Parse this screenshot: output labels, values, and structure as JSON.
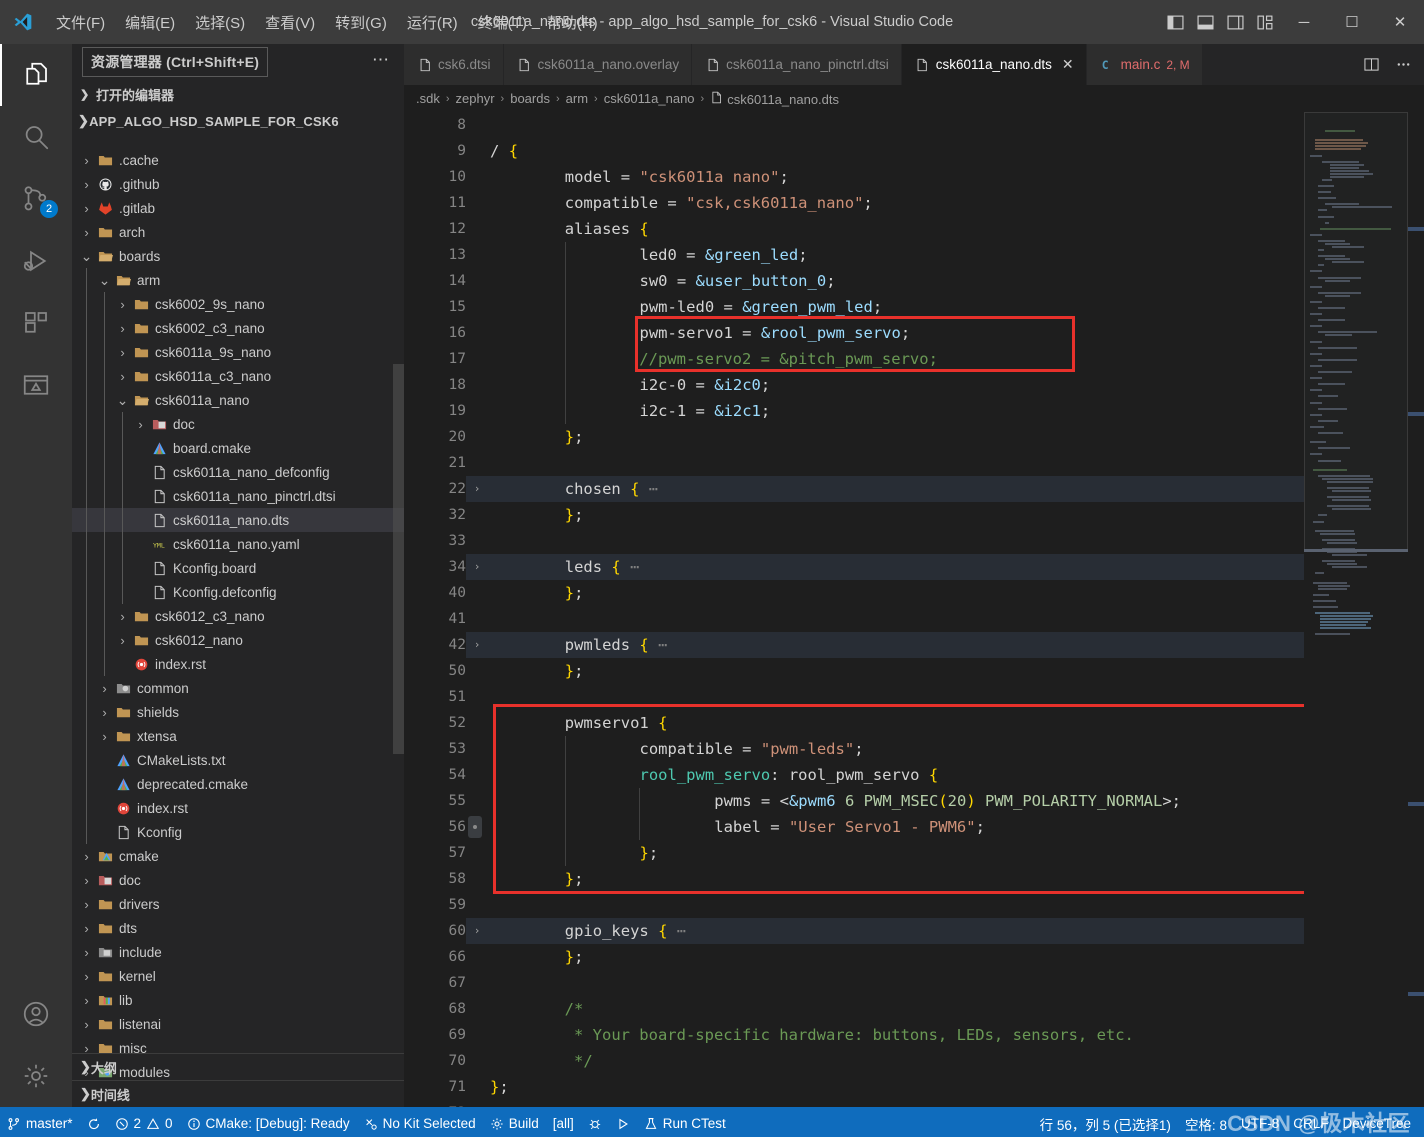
{
  "titlebar": {
    "logo_icon": "vscode-logo-icon",
    "menus": [
      "文件(F)",
      "编辑(E)",
      "选择(S)",
      "查看(V)",
      "转到(G)",
      "运行(R)",
      "终端(T)",
      "帮助(H)"
    ],
    "window_title": "csk6011a_nano.dts - app_algo_hsd_sample_for_csk6 - Visual Studio Code",
    "layout_icons": [
      "toggle-primary-sidebar-icon",
      "toggle-panel-icon",
      "toggle-secondary-sidebar-icon",
      "customize-layout-icon"
    ],
    "window_controls": {
      "minimize": "─",
      "maximize": "☐",
      "close": "✕"
    }
  },
  "activitybar": {
    "items": [
      {
        "name": "explorer",
        "icon": "files-icon",
        "badge": ""
      },
      {
        "name": "search",
        "icon": "search-icon",
        "badge": ""
      },
      {
        "name": "source-control",
        "icon": "source-control-icon",
        "badge": "2"
      },
      {
        "name": "run-and-debug",
        "icon": "run-debug-icon",
        "badge": ""
      },
      {
        "name": "extensions",
        "icon": "extensions-icon",
        "badge": ""
      },
      {
        "name": "embedded-tools",
        "icon": "embedded-icon",
        "badge": ""
      }
    ],
    "bottom": [
      {
        "name": "accounts",
        "icon": "account-icon"
      },
      {
        "name": "manage",
        "icon": "gear-icon"
      }
    ]
  },
  "sidebar": {
    "title": "资源管理器 (Ctrl+Shift+E)",
    "more_actions": "⋯",
    "open_editors_label": "打开的编辑器",
    "root_label": "APP_ALGO_HSD_SAMPLE_FOR_CSK6",
    "bottom_panels": [
      "大纲",
      "时间线"
    ],
    "tree": [
      {
        "label": ".cache",
        "indent": 1,
        "type": "folder",
        "expandable": true,
        "expanded": false
      },
      {
        "label": ".github",
        "indent": 1,
        "type": "github",
        "expandable": true,
        "expanded": false
      },
      {
        "label": ".gitlab",
        "indent": 1,
        "type": "gitlab",
        "expandable": true,
        "expanded": false
      },
      {
        "label": "arch",
        "indent": 1,
        "type": "folder",
        "expandable": true,
        "expanded": false
      },
      {
        "label": "boards",
        "indent": 1,
        "type": "folder-open",
        "expandable": true,
        "expanded": true
      },
      {
        "label": "arm",
        "indent": 2,
        "type": "folder-open",
        "expandable": true,
        "expanded": true
      },
      {
        "label": "csk6002_9s_nano",
        "indent": 3,
        "type": "folder",
        "expandable": true,
        "expanded": false
      },
      {
        "label": "csk6002_c3_nano",
        "indent": 3,
        "type": "folder",
        "expandable": true,
        "expanded": false
      },
      {
        "label": "csk6011a_9s_nano",
        "indent": 3,
        "type": "folder",
        "expandable": true,
        "expanded": false
      },
      {
        "label": "csk6011a_c3_nano",
        "indent": 3,
        "type": "folder",
        "expandable": true,
        "expanded": false
      },
      {
        "label": "csk6011a_nano",
        "indent": 3,
        "type": "folder-open",
        "expandable": true,
        "expanded": true
      },
      {
        "label": "doc",
        "indent": 4,
        "type": "doc-folder",
        "expandable": true,
        "expanded": false
      },
      {
        "label": "board.cmake",
        "indent": 4,
        "type": "cmake",
        "expandable": false,
        "expanded": false
      },
      {
        "label": "csk6011a_nano_defconfig",
        "indent": 4,
        "type": "file",
        "expandable": false,
        "expanded": false
      },
      {
        "label": "csk6011a_nano_pinctrl.dtsi",
        "indent": 4,
        "type": "file",
        "expandable": false,
        "expanded": false
      },
      {
        "label": "csk6011a_nano.dts",
        "indent": 4,
        "type": "file",
        "expandable": false,
        "expanded": false,
        "selected": true
      },
      {
        "label": "csk6011a_nano.yaml",
        "indent": 4,
        "type": "yaml",
        "expandable": false,
        "expanded": false
      },
      {
        "label": "Kconfig.board",
        "indent": 4,
        "type": "file",
        "expandable": false,
        "expanded": false
      },
      {
        "label": "Kconfig.defconfig",
        "indent": 4,
        "type": "file",
        "expandable": false,
        "expanded": false
      },
      {
        "label": "csk6012_c3_nano",
        "indent": 3,
        "type": "folder",
        "expandable": true,
        "expanded": false
      },
      {
        "label": "csk6012_nano",
        "indent": 3,
        "type": "folder",
        "expandable": true,
        "expanded": false
      },
      {
        "label": "index.rst",
        "indent": 3,
        "type": "rst",
        "expandable": false,
        "expanded": false
      },
      {
        "label": "common",
        "indent": 2,
        "type": "mod-folder",
        "expandable": true,
        "expanded": false
      },
      {
        "label": "shields",
        "indent": 2,
        "type": "folder",
        "expandable": true,
        "expanded": false
      },
      {
        "label": "xtensa",
        "indent": 2,
        "type": "folder",
        "expandable": true,
        "expanded": false
      },
      {
        "label": "CMakeLists.txt",
        "indent": 2,
        "type": "cmake",
        "expandable": false,
        "expanded": false
      },
      {
        "label": "deprecated.cmake",
        "indent": 2,
        "type": "cmake",
        "expandable": false,
        "expanded": false
      },
      {
        "label": "index.rst",
        "indent": 2,
        "type": "rst",
        "expandable": false,
        "expanded": false
      },
      {
        "label": "Kconfig",
        "indent": 2,
        "type": "file",
        "expandable": false,
        "expanded": false
      },
      {
        "label": "cmake",
        "indent": 1,
        "type": "cmake-folder",
        "expandable": true,
        "expanded": false
      },
      {
        "label": "doc",
        "indent": 1,
        "type": "doc-folder",
        "expandable": true,
        "expanded": false
      },
      {
        "label": "drivers",
        "indent": 1,
        "type": "folder",
        "expandable": true,
        "expanded": false
      },
      {
        "label": "dts",
        "indent": 1,
        "type": "folder",
        "expandable": true,
        "expanded": false
      },
      {
        "label": "include",
        "indent": 1,
        "type": "inc-folder",
        "expandable": true,
        "expanded": false
      },
      {
        "label": "kernel",
        "indent": 1,
        "type": "folder",
        "expandable": true,
        "expanded": false
      },
      {
        "label": "lib",
        "indent": 1,
        "type": "lib-folder",
        "expandable": true,
        "expanded": false
      },
      {
        "label": "listenai",
        "indent": 1,
        "type": "folder",
        "expandable": true,
        "expanded": false
      },
      {
        "label": "misc",
        "indent": 1,
        "type": "folder",
        "expandable": true,
        "expanded": false
      },
      {
        "label": "modules",
        "indent": 1,
        "type": "mod2-folder",
        "expandable": true,
        "expanded": false
      }
    ]
  },
  "editor": {
    "tabs": [
      {
        "label": "csk6.dtsi",
        "icon": "file-icon",
        "active": false,
        "dirty": false,
        "close": ""
      },
      {
        "label": "csk6011a_nano.overlay",
        "icon": "file-icon",
        "active": false,
        "dirty": false,
        "close": ""
      },
      {
        "label": "csk6011a_nano_pinctrl.dtsi",
        "icon": "file-icon",
        "active": false,
        "dirty": false,
        "close": ""
      },
      {
        "label": "csk6011a_nano.dts",
        "icon": "file-icon",
        "active": true,
        "dirty": false,
        "close": "✕"
      },
      {
        "label": "main.c",
        "icon": "c-icon",
        "active": false,
        "dirty": true,
        "close": "",
        "badge": "2, M"
      }
    ],
    "tab_actions": [
      "split-editor-icon",
      "more-actions-icon"
    ],
    "breadcrumb": [
      ".sdk",
      "zephyr",
      "boards",
      "arm",
      "csk6011a_nano",
      "csk6011a_nano.dts"
    ],
    "lines": [
      {
        "n": "8",
        "text": ""
      },
      {
        "n": "9",
        "text": "/ {"
      },
      {
        "n": "10",
        "text": "        model = \"csk6011a nano\";"
      },
      {
        "n": "11",
        "text": "        compatible = \"csk,csk6011a_nano\";"
      },
      {
        "n": "12",
        "text": "        aliases {"
      },
      {
        "n": "13",
        "text": "                led0 = &green_led;"
      },
      {
        "n": "14",
        "text": "                sw0 = &user_button_0;"
      },
      {
        "n": "15",
        "text": "                pwm-led0 = &green_pwm_led;"
      },
      {
        "n": "16",
        "text": "                pwm-servo1 = &rool_pwm_servo;"
      },
      {
        "n": "17",
        "text": "                //pwm-servo2 = &pitch_pwm_servo;"
      },
      {
        "n": "18",
        "text": "                i2c-0 = &i2c0;"
      },
      {
        "n": "19",
        "text": "                i2c-1 = &i2c1;"
      },
      {
        "n": "20",
        "text": "        };"
      },
      {
        "n": "21",
        "text": ""
      },
      {
        "n": "22",
        "text": "        chosen { ⋯",
        "folded": true,
        "highlight": true
      },
      {
        "n": "32",
        "text": "        };"
      },
      {
        "n": "33",
        "text": ""
      },
      {
        "n": "34",
        "text": "        leds { ⋯",
        "folded": true,
        "highlight": true
      },
      {
        "n": "40",
        "text": "        };"
      },
      {
        "n": "41",
        "text": ""
      },
      {
        "n": "42",
        "text": "        pwmleds { ⋯",
        "folded": true,
        "highlight": true
      },
      {
        "n": "50",
        "text": "        };"
      },
      {
        "n": "51",
        "text": ""
      },
      {
        "n": "52",
        "text": "        pwmservo1 {"
      },
      {
        "n": "53",
        "text": "                compatible = \"pwm-leds\";"
      },
      {
        "n": "54",
        "text": "                rool_pwm_servo: rool_pwm_servo {"
      },
      {
        "n": "55",
        "text": "                        pwms = <&pwm6 6 PWM_MSEC(20) PWM_POLARITY_NORMAL>;"
      },
      {
        "n": "56",
        "text": "                        label = \"User Servo1 - PWM6\";"
      },
      {
        "n": "57",
        "text": "                };"
      },
      {
        "n": "58",
        "text": "        };"
      },
      {
        "n": "59",
        "text": ""
      },
      {
        "n": "60",
        "text": "        gpio_keys { ⋯",
        "folded": true,
        "highlight": true
      },
      {
        "n": "66",
        "text": "        };"
      },
      {
        "n": "67",
        "text": ""
      },
      {
        "n": "68",
        "text": "        /*"
      },
      {
        "n": "69",
        "text": "         * Your board-specific hardware: buttons, LEDs, sensors, etc."
      },
      {
        "n": "70",
        "text": "         */"
      },
      {
        "n": "71",
        "text": "};"
      },
      {
        "n": "72",
        "text": ""
      }
    ]
  },
  "statusbar": {
    "left": [
      {
        "icon": "source-control-branch-icon",
        "label": "master*"
      },
      {
        "icon": "sync-icon",
        "label": ""
      },
      {
        "icon": "error-icon",
        "label": "2",
        "icon2": "warning-icon",
        "label2": "0"
      },
      {
        "icon": "info-icon",
        "label": "CMake: [Debug]: Ready"
      },
      {
        "icon": "kit-icon",
        "label": "No Kit Selected"
      },
      {
        "icon": "gear-icon",
        "label": "Build"
      },
      {
        "icon": "",
        "label": "[all]"
      },
      {
        "icon": "debug-icon",
        "label": ""
      },
      {
        "icon": "play-icon",
        "label": ""
      },
      {
        "icon": "beaker-icon",
        "label": "Run CTest"
      }
    ],
    "right": [
      {
        "label": "行 56，列 5 (已选择1)"
      },
      {
        "label": "空格: 8"
      },
      {
        "label": "UTF-8"
      },
      {
        "label": "CRLF"
      },
      {
        "label": "DeviceTree"
      }
    ],
    "watermark": "CSDN @极木社区",
    "accent_color": "#0f6cbd"
  }
}
